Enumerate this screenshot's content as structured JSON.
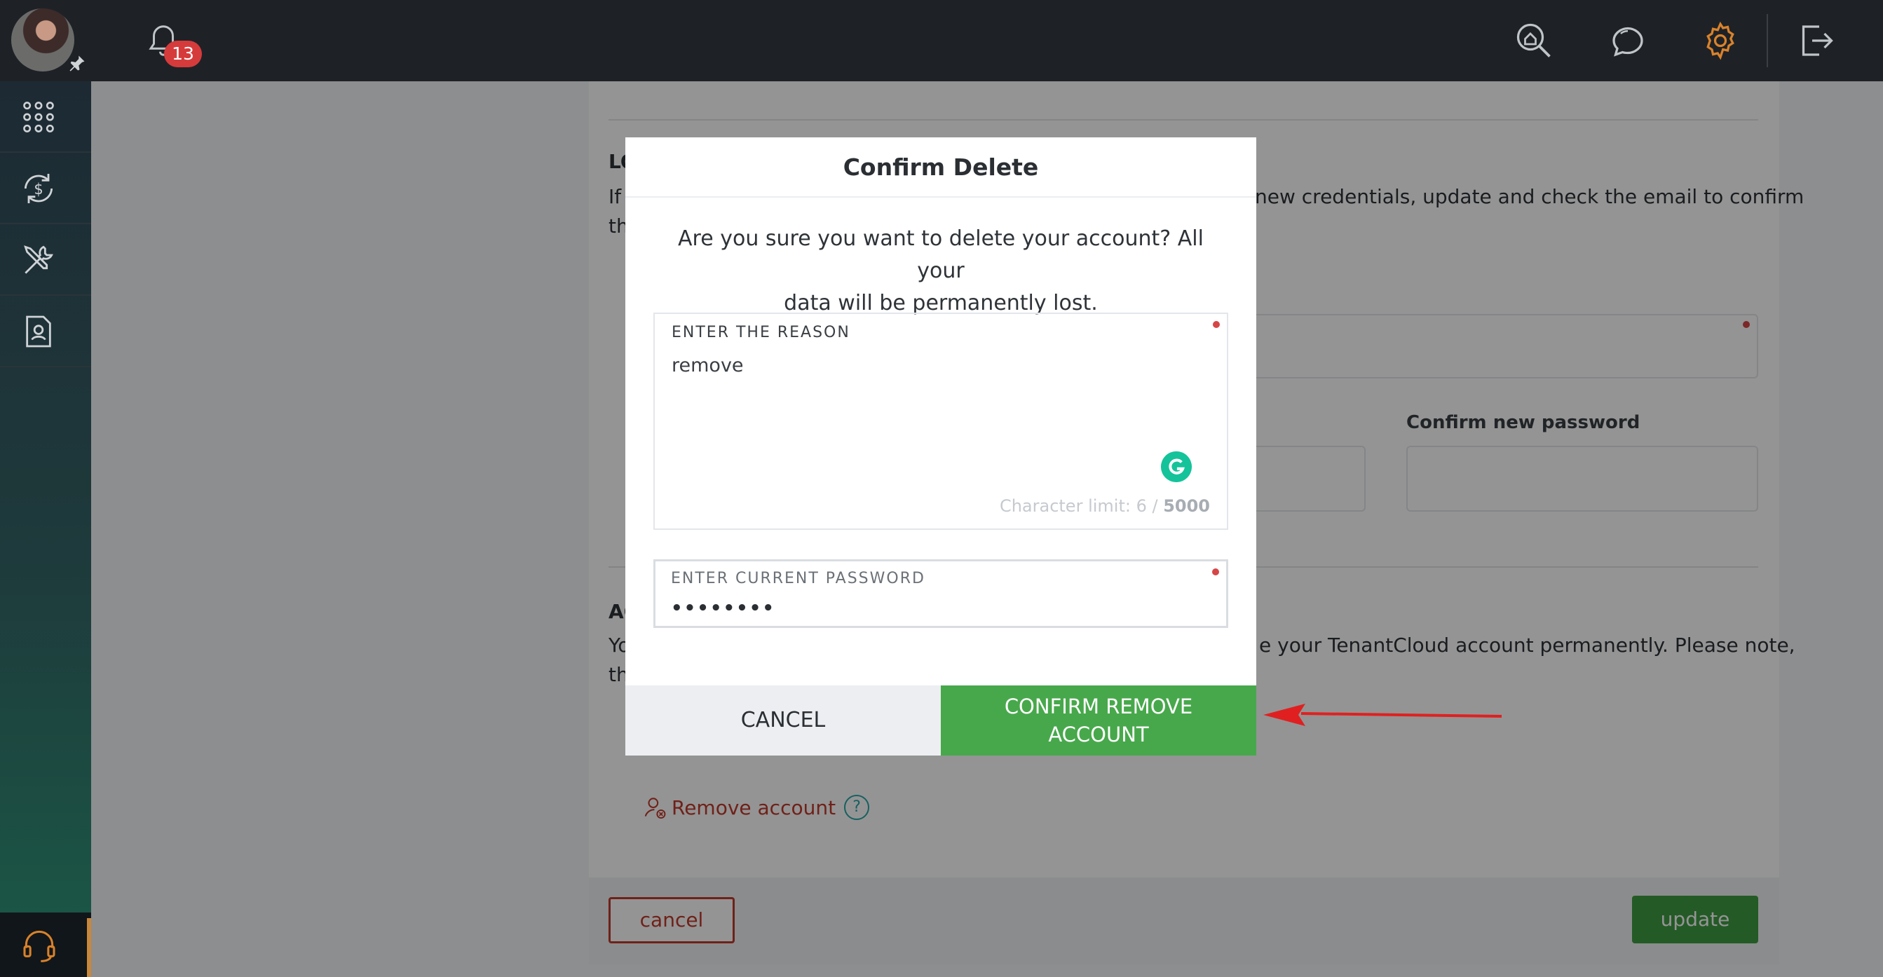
{
  "header": {
    "notifications_count": "13",
    "icons": [
      "search-home-icon",
      "chat-icon",
      "gear-icon",
      "logout-icon"
    ],
    "gear_color": "#d9822b"
  },
  "sidebar": {
    "items": [
      "apps-grid-icon",
      "money-cycle-icon",
      "tools-icon",
      "user-document-icon"
    ],
    "help": "headset-icon"
  },
  "background": {
    "section1_title": "LO",
    "section1_text_left": "If",
    "section1_text_right": "new credentials, update and check the email to confirm",
    "section1_text_line2": "th",
    "confirm_password_label": "Confirm new password",
    "section2_title": "AC",
    "section2_text_left": "Yo",
    "section2_text_right": "e your TenantCloud account permanently. Please note,",
    "section2_text_line2": "th",
    "remove_account_link": "Remove account",
    "help_mark": "?",
    "cancel_label": "cancel",
    "update_label": "update"
  },
  "modal": {
    "title": "Confirm Delete",
    "message_line1": "Are you sure you want to delete your account? All your",
    "message_line2": "data will be permanently lost.",
    "reason_label": "ENTER THE REASON",
    "reason_value": "remove",
    "char_limit_prefix": "Character limit: 6 /",
    "char_limit_max": "5000",
    "password_label": "ENTER CURRENT PASSWORD",
    "password_value": "••••••••",
    "cancel_label": "CANCEL",
    "confirm_label_line1": "CONFIRM REMOVE",
    "confirm_label_line2": "ACCOUNT"
  },
  "colors": {
    "confirm_green": "#47a84b",
    "update_green": "#3f9b43",
    "danger_red": "#c0392b",
    "annotation_arrow": "#e02020"
  }
}
